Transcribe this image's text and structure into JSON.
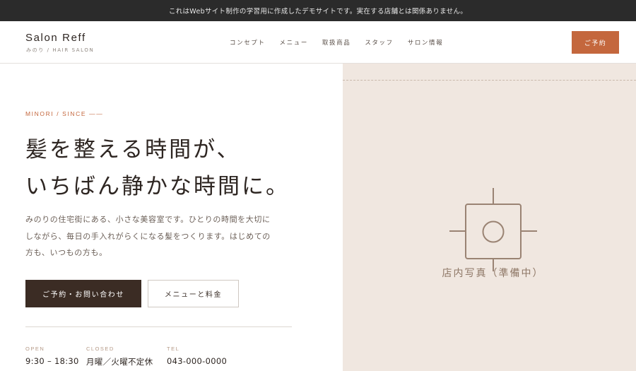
{
  "notice": {
    "text": "これはWebサイト制作の学習用に作成したデモサイトです。実在する店舗とは関係ありません。"
  },
  "brand": {
    "name": "Salon Reff",
    "sub": "みのり / HAIR SALON"
  },
  "nav": {
    "items": [
      "コンセプト",
      "メニュー",
      "取扱商品",
      "スタッフ",
      "サロン情報"
    ]
  },
  "header": {
    "reserve_label": "ご予約"
  },
  "hero": {
    "eyebrow": "MINORI / SINCE ——",
    "headline_line1": "髪を整える時間が、",
    "headline_line2": "いちばん静かな時間に。",
    "lead_line1": "みのりの住宅街にある、小さな美容室です。ひとりの時間を大切に",
    "lead_line2": "しながら、毎日の手入れがらくになる髪をつくります。はじめての",
    "lead_line3": "方も、いつもの方も。",
    "primary_button": "ご予約・お問い合わせ",
    "secondary_button": "メニューと料金"
  },
  "info": {
    "open_label": "OPEN",
    "open_value": "9:30 – 18:30",
    "closed_label": "CLOSED",
    "closed_value": "月曜／火曜不定休",
    "tel_label": "TEL",
    "tel_value": "043-000-0000"
  },
  "photo": {
    "placeholder_label": "店内写真（準備中）",
    "icon": "camera-placeholder-icon"
  },
  "colors": {
    "accent": "#c4673d",
    "dark_button": "#3b2c24",
    "panel_bg": "#f0e7e0",
    "notice_bg": "#2b2b2b"
  }
}
